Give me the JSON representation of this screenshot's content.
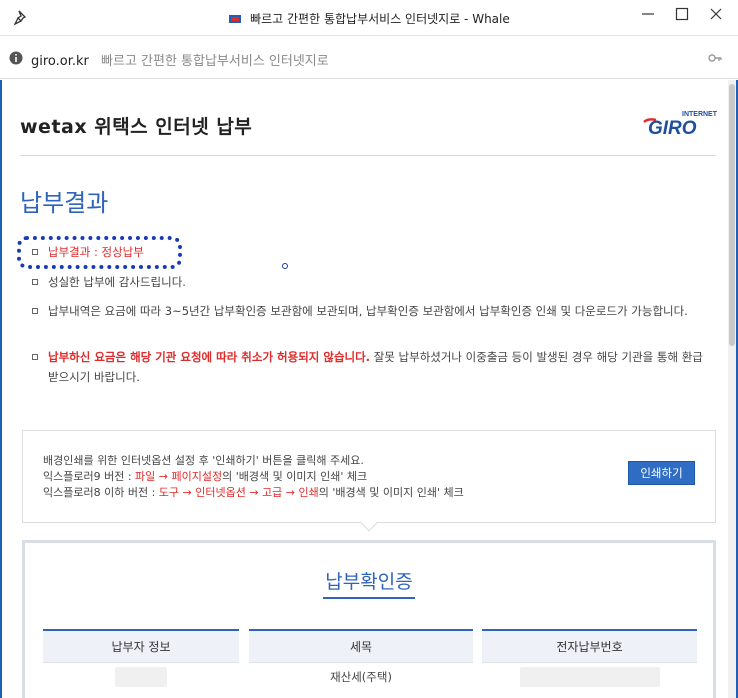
{
  "window": {
    "title": "빠르고 간편한 통합납부서비스 인터넷지로 - Whale"
  },
  "addressbar": {
    "domain": "giro.or.kr",
    "page_title": "빠르고 간편한 통합납부서비스 인터넷지로"
  },
  "site": {
    "title": "wetax 위택스 인터넷 납부",
    "logo_small": "INTERNET",
    "logo_text": "GIRO"
  },
  "result": {
    "heading": "납부결과",
    "bullets": {
      "status": "납부결과 : 정상납부",
      "thanks": "성실한 납부에 감사드립니다.",
      "storage": "납부내역은 요금에 따라 3~5년간 납부확인증 보관함에 보관되며, 납부확인증 보관함에서 납부확인증 인쇄 및 다운로드가 가능합니다.",
      "warning_red": "납부하신 요금은 해당 기관 요청에 따라 취소가 허용되지 않습니다.",
      "warning_rest": " 잘못 납부하셨거나 이중출금 등이 발생된 경우 해당 기관을 통해 환급받으시기 바랍니다."
    }
  },
  "print_guide": {
    "line1": "배경인쇄를 위한 인터넷옵션 설정 후 '인쇄하기' 버튼을 클릭해 주세요.",
    "line2_prefix": "익스플로러9 버전 : ",
    "line2_red": "파일 → 페이지설정",
    "line2_suffix": "의 '배경색 및 이미지 인쇄' 체크",
    "line3_prefix": "익스플로러8 이하 버전 : ",
    "line3_red": "도구 → 인터넷옵션 → 고급 → 인쇄",
    "line3_suffix": "의 '배경색 및 이미지 인쇄' 체크",
    "button": "인쇄하기"
  },
  "certificate": {
    "title": "납부확인증",
    "columns": [
      "납부자 정보",
      "세목",
      "전자납부번호"
    ],
    "row": [
      "",
      "재산세(주택)",
      ""
    ]
  }
}
